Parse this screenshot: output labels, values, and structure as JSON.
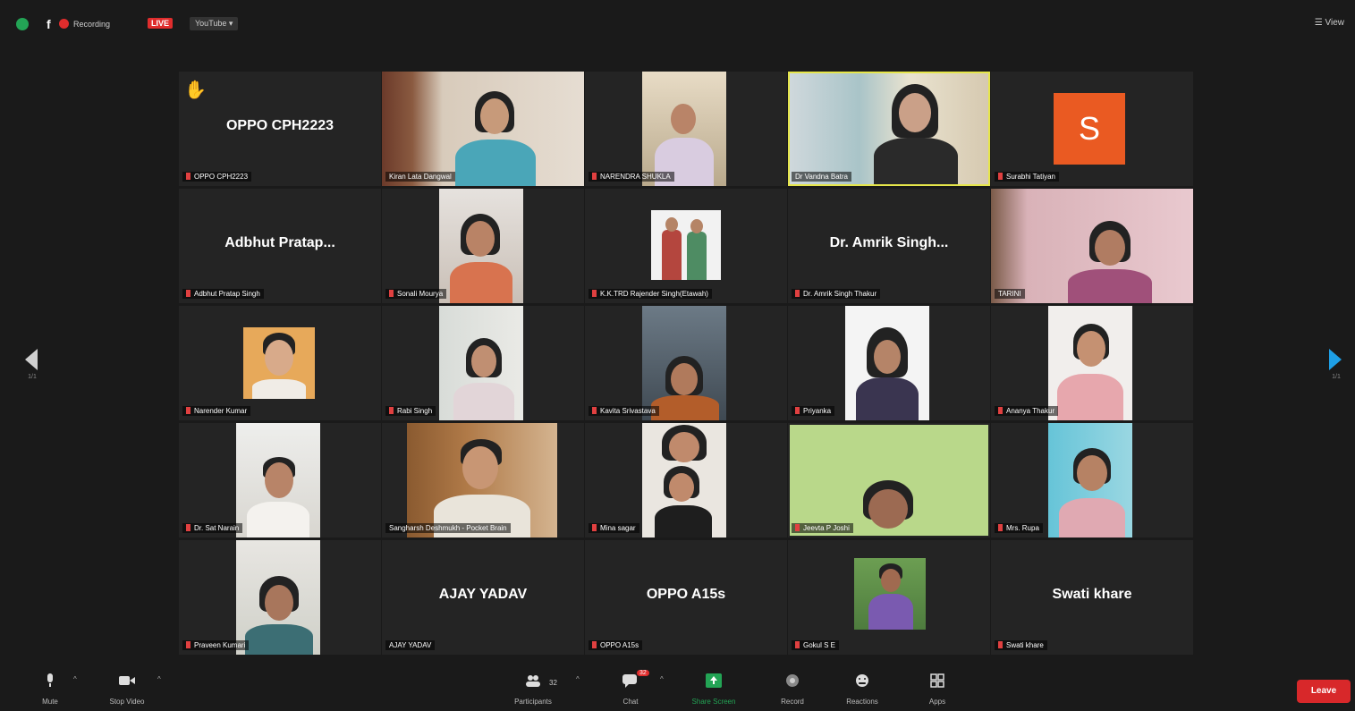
{
  "topbar": {
    "recording": "Recording",
    "live": "LIVE",
    "youtube": "YouTube ▾",
    "view": "☰ View"
  },
  "nav": {
    "left_page": "1/1",
    "right_page": "1/1"
  },
  "tiles": [
    {
      "label": "OPPO CPH2223",
      "display_name": "OPPO CPH2223",
      "hand": "✋"
    },
    {
      "label": "Kiran Lata Dangwal"
    },
    {
      "label": "NARENDRA SHUKLA"
    },
    {
      "label": "Dr Vandna Batra"
    },
    {
      "label": "Surabhi Tatiyan",
      "avatar": "S"
    },
    {
      "label": "Adbhut Pratap Singh",
      "display_name": "Adbhut  Pratap..."
    },
    {
      "label": "Sonali Mourya"
    },
    {
      "label": "K.K.TRD Rajender Singh(Etawah)"
    },
    {
      "label": "Dr. Amrik Singh Thakur",
      "display_name": "Dr. Amrik  Singh..."
    },
    {
      "label": "TARINI"
    },
    {
      "label": "Narender Kumar"
    },
    {
      "label": "Rabi Singh"
    },
    {
      "label": "Kavita Srivastava"
    },
    {
      "label": "Priyanka"
    },
    {
      "label": "Ananya Thakur"
    },
    {
      "label": "Dr. Sat Narain"
    },
    {
      "label": "Sangharsh Deshmukh - Pocket Brain"
    },
    {
      "label": "Mina sagar"
    },
    {
      "label": "Jeevta P Joshi"
    },
    {
      "label": "Mrs. Rupa"
    },
    {
      "label": "Praveen Kumari"
    },
    {
      "label": "AJAY YADAV",
      "display_name": "AJAY YADAV"
    },
    {
      "label": "OPPO A15s",
      "display_name": "OPPO A15s"
    },
    {
      "label": "Gokul S E"
    },
    {
      "label": "Swati khare",
      "display_name": "Swati khare"
    }
  ],
  "toolbar": {
    "mute": "Mute",
    "stop_video": "Stop Video",
    "participants": "Participants",
    "participants_count": "32",
    "chat": "Chat",
    "chat_badge": "32",
    "share_screen": "Share Screen",
    "record": "Record",
    "reactions": "Reactions",
    "apps": "Apps",
    "leave": "Leave"
  },
  "colors": {
    "background": "#1a1a1a",
    "tile": "#242424",
    "live_red": "#e02d2d",
    "share_green": "#23a455",
    "active_speaker": "#e6e64b",
    "nav_blue": "#1e9fe6",
    "avatar_orange": "#ea5a22"
  }
}
